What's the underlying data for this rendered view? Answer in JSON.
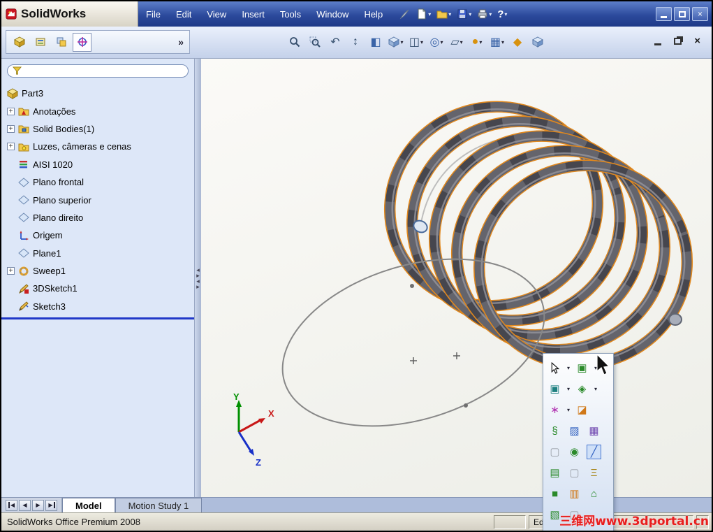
{
  "window": {
    "title": "SolidWorks",
    "menus": [
      "File",
      "Edit",
      "View",
      "Insert",
      "Tools",
      "Window",
      "Help"
    ],
    "help_glyph": "?"
  },
  "icons": {
    "caret": "▾",
    "overflow": "»",
    "close": "×",
    "plus": "+",
    "undo_view": "↶",
    "pan_updown": "↕",
    "section_view": "◧",
    "display_style": "◫",
    "hide_show_items": "◎",
    "shadows": "▱",
    "appearance_ball": "●",
    "scene": "▦",
    "lights": "◆",
    "nav_prev": "◀",
    "nav_next": "▶",
    "splitter_left": "◂",
    "splitter_right": "▸"
  },
  "feature_tree": {
    "items": [
      {
        "label": "Part3"
      },
      {
        "label": "Anotações"
      },
      {
        "label": "Solid Bodies(1)"
      },
      {
        "label": "Luzes, câmeras e cenas"
      },
      {
        "label": "AISI 1020"
      },
      {
        "label": "Plano frontal"
      },
      {
        "label": "Plano superior"
      },
      {
        "label": "Plano direito"
      },
      {
        "label": "Origem"
      },
      {
        "label": "Plane1"
      },
      {
        "label": "Sweep1"
      },
      {
        "label": "3DSketch1"
      },
      {
        "label": "Sketch3"
      }
    ]
  },
  "viewport": {
    "triad": {
      "x": "X",
      "y": "Y",
      "z": "Z"
    }
  },
  "shortcut_bar": {
    "select_group": "▣",
    "box_select": "▣",
    "convert": "◈",
    "dimension": "∗",
    "trim": "◪",
    "helix": "§",
    "sketch3d": "▨",
    "appearance": "▦",
    "disabled_a": "▢",
    "surface": "◉",
    "measure": "╱",
    "library": "▤",
    "disabled_b": "▢",
    "mass_props": "Ξ",
    "plane_tool": "■",
    "box_tool": "▥",
    "home": "⌂",
    "partial_a": "▧",
    "partial_b": "▢"
  },
  "bottom": {
    "tabs": [
      "Model",
      "Motion Study 1"
    ],
    "status_left": "SolidWorks Office Premium 2008",
    "status_right": "Ed",
    "watermark": "三维网www.3dportal.cn"
  }
}
